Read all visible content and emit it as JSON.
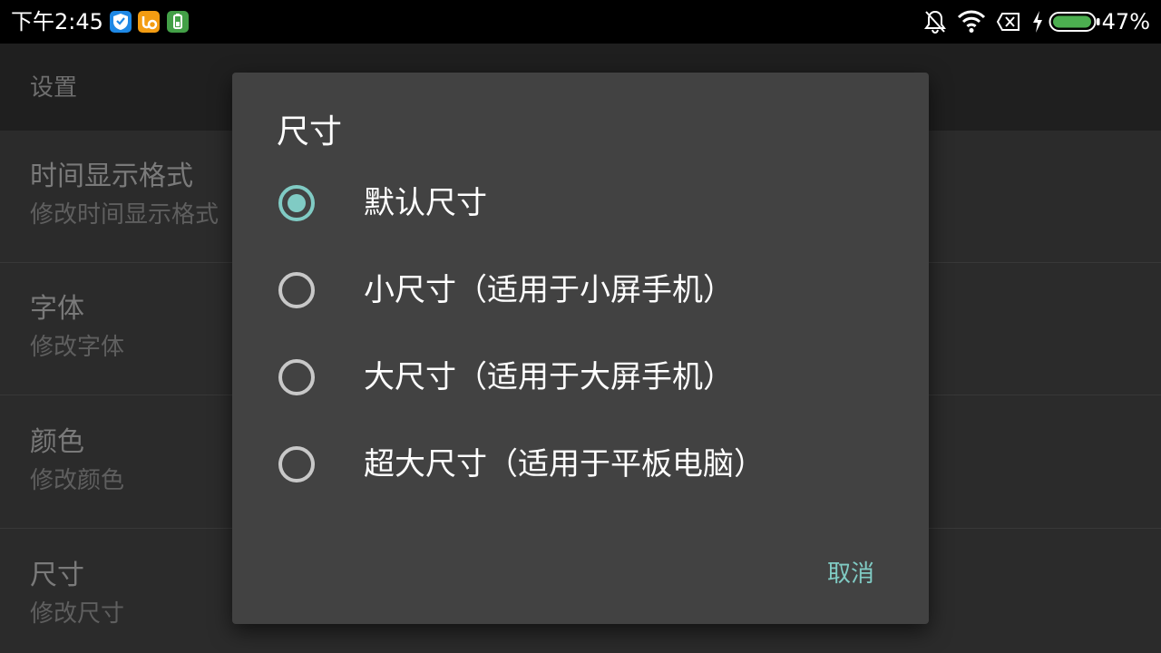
{
  "status_bar": {
    "time": "下午2:45",
    "battery_percent": "47%",
    "battery_level": 0.47,
    "icons": [
      "shield-app-icon",
      "uc-browser-app-icon",
      "battery-app-icon",
      "bell-off-icon",
      "wifi-icon",
      "sim-off-icon",
      "charging-icon",
      "battery-icon"
    ]
  },
  "settings": {
    "title": "设置",
    "items": [
      {
        "title": "时间显示格式",
        "subtitle": "修改时间显示格式"
      },
      {
        "title": "字体",
        "subtitle": "修改字体"
      },
      {
        "title": "颜色",
        "subtitle": "修改颜色"
      },
      {
        "title": "尺寸",
        "subtitle": "修改尺寸"
      }
    ]
  },
  "dialog": {
    "title": "尺寸",
    "options": [
      {
        "label": "默认尺寸",
        "selected": true
      },
      {
        "label": "小尺寸（适用于小屏手机）",
        "selected": false
      },
      {
        "label": "大尺寸（适用于大屏手机）",
        "selected": false
      },
      {
        "label": "超大尺寸（适用于平板电脑）",
        "selected": false
      }
    ],
    "cancel_label": "取消"
  },
  "colors": {
    "accent": "#80cbc4",
    "dialog_bg": "#424242",
    "status_bar_bg": "#000000"
  }
}
